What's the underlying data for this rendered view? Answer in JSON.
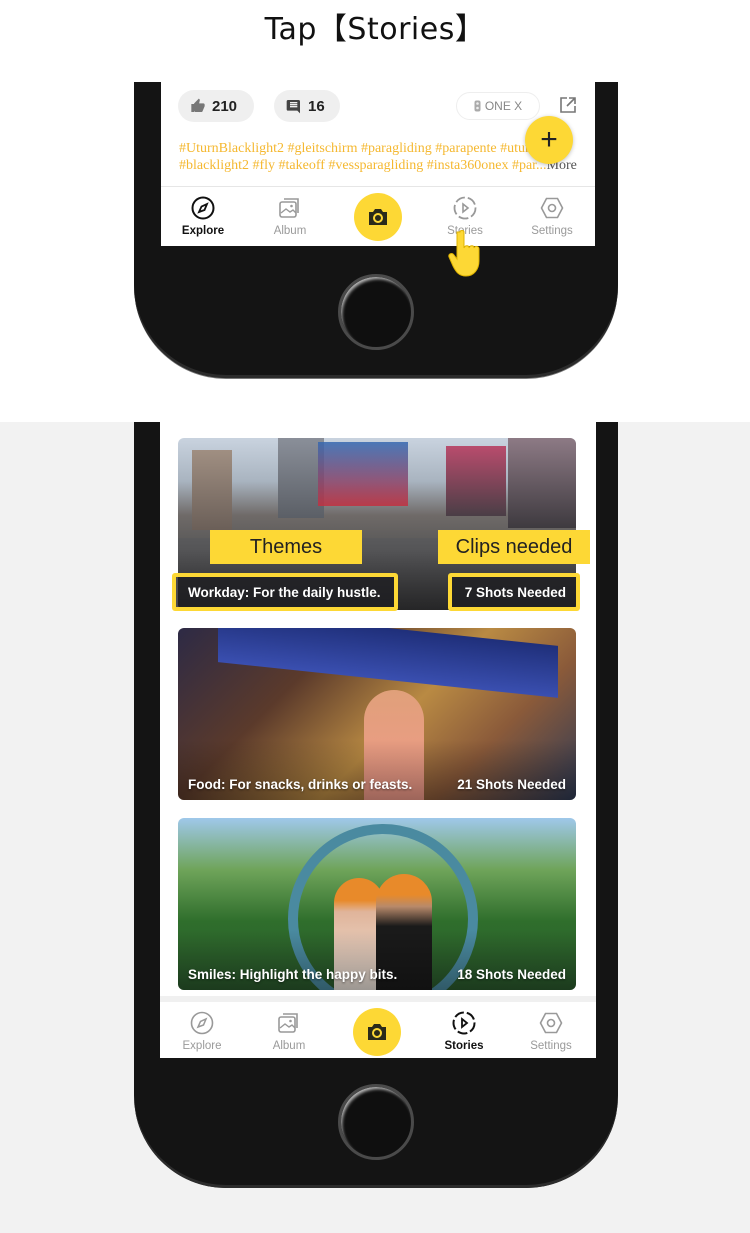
{
  "instruction": "Tap【Stories】",
  "colors": {
    "accent": "#fdd835",
    "hashtag": "#f5b830",
    "tab_inactive": "#9a9a9a",
    "tab_active": "#111111"
  },
  "feed_post": {
    "likes": "210",
    "comments": "16",
    "camera_model": "ONE X",
    "hashtags_line1": "#UturnBlacklight2 #gleitschirm #paragliding #parapente #utur",
    "hashtags_line2": "#blacklight2 #fly #takeoff #vessparagliding #insta360onex #par...",
    "more_label": "More",
    "fab_icon": "plus-icon"
  },
  "tabbar": {
    "items": [
      {
        "label": "Explore",
        "icon": "compass-icon"
      },
      {
        "label": "Album",
        "icon": "album-icon"
      },
      {
        "label": "",
        "icon": "camera-icon"
      },
      {
        "label": "Stories",
        "icon": "stories-play-icon"
      },
      {
        "label": "Settings",
        "icon": "settings-hexagon-icon"
      }
    ]
  },
  "step1": {
    "active_tab": "Explore",
    "pointer": "hand-pointer-icon",
    "pointer_target": "Stories"
  },
  "step2": {
    "active_tab": "Stories",
    "annotations": {
      "themes_label": "Themes",
      "clips_label": "Clips needed"
    },
    "stories": [
      {
        "theme": "Workday: For the daily hustle.",
        "shots": "7 Shots Needed"
      },
      {
        "theme": "Food: For snacks, drinks or feasts.",
        "shots": "21 Shots Needed"
      },
      {
        "theme": "Smiles: Highlight the happy bits.",
        "shots": "18 Shots Needed"
      }
    ]
  }
}
